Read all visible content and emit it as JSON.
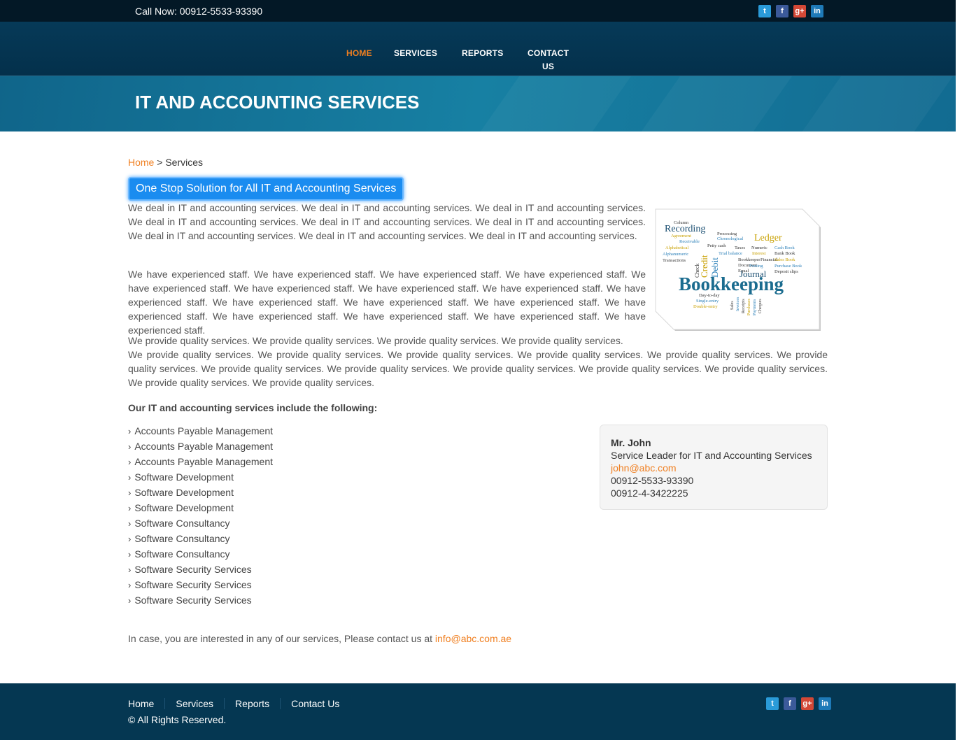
{
  "topbar": {
    "phone": "Call Now: 00912-5533-93390"
  },
  "social": [
    "t",
    "f",
    "g+",
    "in"
  ],
  "nav": {
    "home": "HOME",
    "services": "SERVICES",
    "reports": "REPORTS",
    "contact_line1": "CONTACT",
    "contact_line2": "US"
  },
  "banner": {
    "title": "IT AND ACCOUNTING SERVICES"
  },
  "breadcrumb": {
    "home": "Home",
    "separator": " > ",
    "current": "Services"
  },
  "heading": "One Stop Solution for All IT and Accounting Services",
  "paragraphs": [
    "We deal in IT and accounting services. We deal in IT and accounting services. We deal in IT and accounting services. We deal in IT and accounting services. We deal in IT and accounting services. We deal in IT and accounting services. We deal in IT and accounting services. We deal in IT and accounting services. We deal in IT and accounting services.",
    "We have experienced staff. We have experienced staff. We have experienced staff. We have experienced staff. We have experienced staff. We have experienced staff. We have experienced staff. We have experienced staff. We have experienced staff. We have experienced staff. We have experienced staff. We have experienced staff. We have experienced staff. We have experienced staff. We have experienced staff. We have experienced staff. We have experienced staff.",
    "We provide quality services. We provide quality services. We provide quality services. We provide quality services.",
    "We provide quality services. We provide quality services. We provide quality services. We provide quality services. We provide quality services. We provide quality services. We provide quality services. We provide quality services. We provide quality services. We provide quality services. We provide quality services. We provide quality services. We provide quality services."
  ],
  "image_words": {
    "w1": "Column",
    "w2": "Recording",
    "w3": "Agreement",
    "w4": "Receivable",
    "w5": "Processing",
    "w6": "Chronological",
    "w7": "Ledger",
    "w8": "Alphabetical",
    "w9": "Petty cash",
    "w10": "Taxes",
    "w11": "Numeric",
    "w12": "Cash Book",
    "w13": "Alphanumeric",
    "w14": "Trial balance",
    "w15": "Interest",
    "w16": "Bank Book",
    "w17": "Transactions",
    "w18": "Bookkeeper",
    "w19": "Financial",
    "w20": "Sales Book",
    "w21": "Document",
    "w22": "Posting",
    "w23": "Purchase Book",
    "w24": "Equal",
    "w25": "Deposit slips",
    "w26": "Journal",
    "w27": "Check",
    "w28": "Credit",
    "w29": "Debit",
    "w30": "Bookkeeping",
    "w31": "Day-to-day",
    "w32": "Single-entry",
    "w33": "Double-entry",
    "w34": "Sales",
    "w35": "Invoices",
    "w36": "Receipts",
    "w37": "Purchases",
    "w38": "Payments",
    "w39": "Cheques"
  },
  "includes_heading": "Our IT and accounting services include the following:",
  "services": [
    "Accounts Payable Management",
    "Accounts Payable Management",
    "Accounts Payable Management",
    "Software Development",
    "Software Development",
    "Software Development",
    "Software Consultancy",
    "Software Consultancy",
    "Software Consultancy",
    "Software Security Services",
    "Software Security Services",
    "Software Security Services"
  ],
  "list_arrow": "›",
  "contact_card": {
    "name": "Mr. John",
    "role": "Service Leader for IT and Accounting Services",
    "email": "john@abc.com",
    "phone1": "00912-5533-93390",
    "phone2": "00912-4-3422225"
  },
  "closing": {
    "text": "In case, you are interested in any of our services, Please contact us at ",
    "email": "info@abc.com.ae"
  },
  "footer": {
    "links": [
      "Home",
      "Services",
      "Reports",
      "Contact Us"
    ],
    "copyright": "© All Rights Reserved."
  },
  "colors": {
    "accent": "#f07f20",
    "topbar": "#031826",
    "nav": "#053752",
    "banner": "#1780a3",
    "pill": "#1a8cf0"
  }
}
